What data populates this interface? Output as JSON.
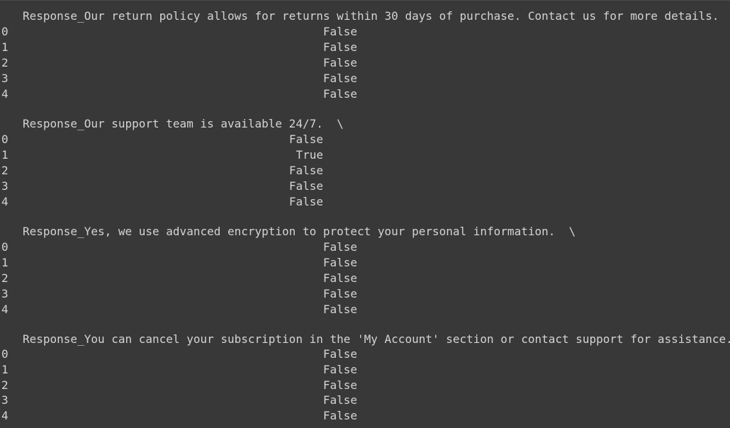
{
  "output": {
    "blocks": [
      {
        "header": "Response_Our return policy allows for returns within 30 days of purchase. Contact us for more details.",
        "rows": [
          {
            "index": "0",
            "value": "False"
          },
          {
            "index": "1",
            "value": "False"
          },
          {
            "index": "2",
            "value": "False"
          },
          {
            "index": "3",
            "value": "False"
          },
          {
            "index": "4",
            "value": "False"
          }
        ]
      },
      {
        "header": "Response_Our support team is available 24/7.  \\",
        "rows": [
          {
            "index": "0",
            "value": "False"
          },
          {
            "index": "1",
            "value": "True"
          },
          {
            "index": "2",
            "value": "False"
          },
          {
            "index": "3",
            "value": "False"
          },
          {
            "index": "4",
            "value": "False"
          }
        ]
      },
      {
        "header": "Response_Yes, we use advanced encryption to protect your personal information.  \\",
        "rows": [
          {
            "index": "0",
            "value": "False"
          },
          {
            "index": "1",
            "value": "False"
          },
          {
            "index": "2",
            "value": "False"
          },
          {
            "index": "3",
            "value": "False"
          },
          {
            "index": "4",
            "value": "False"
          }
        ]
      },
      {
        "header": "Response_You can cancel your subscription in the 'My Account' section or contact support for assistance.",
        "rows": [
          {
            "index": "0",
            "value": "False"
          },
          {
            "index": "1",
            "value": "False"
          },
          {
            "index": "2",
            "value": "False"
          },
          {
            "index": "3",
            "value": "False"
          },
          {
            "index": "4",
            "value": "False"
          }
        ]
      }
    ]
  }
}
